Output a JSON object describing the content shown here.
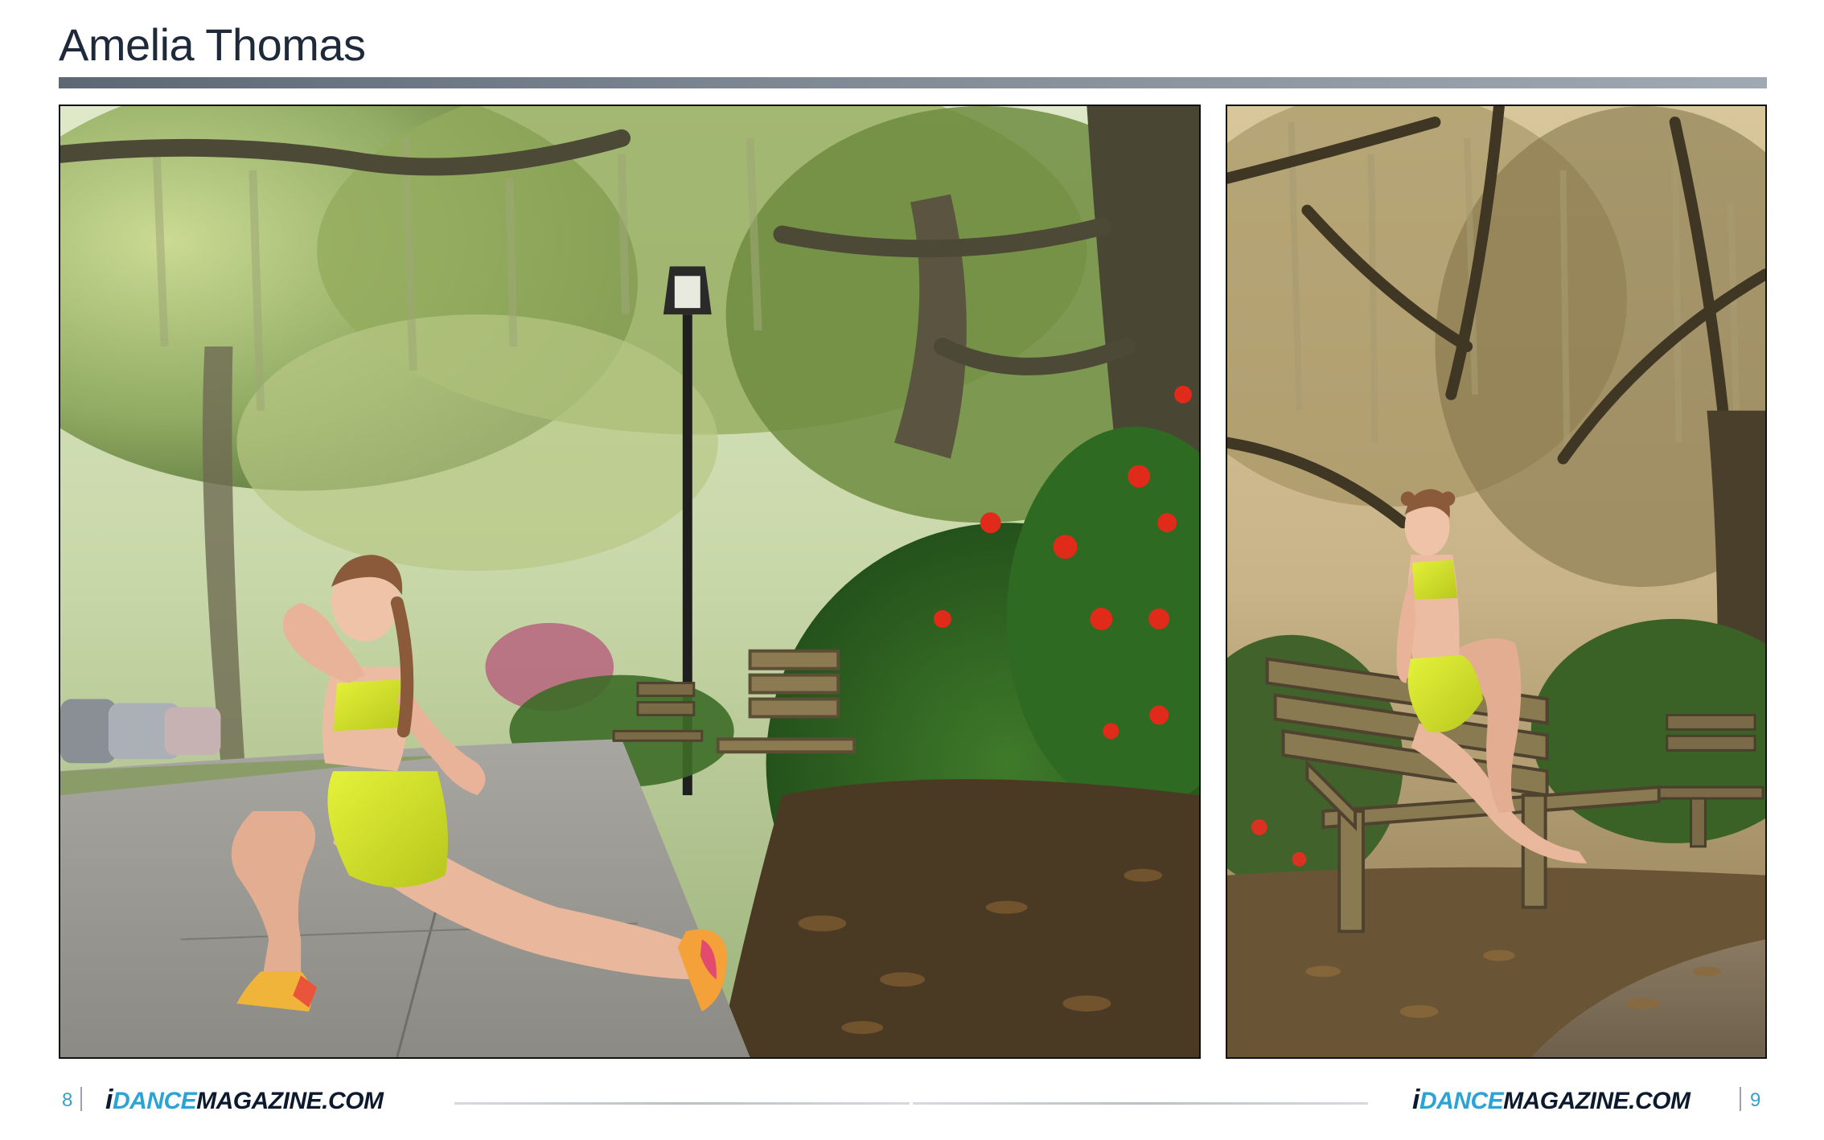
{
  "page": {
    "title": "Amelia Thomas"
  },
  "photos": {
    "left": {
      "subject": "dancer-lunge-street-photo"
    },
    "right": {
      "subject": "dancer-seated-bench-photo"
    }
  },
  "footer": {
    "left_page_number": "8",
    "right_page_number": "9",
    "brand_i": "i",
    "brand_dance": "DANCE",
    "brand_rest": "MAGAZINE.COM"
  },
  "colors": {
    "title_text": "#1e2a3a",
    "rule": "#7f8a95",
    "brand_dark": "#0d1a2e",
    "brand_accent": "#2aa3d6",
    "page_number": "#3aa0c8",
    "outfit_yellow": "#d6e82a"
  }
}
